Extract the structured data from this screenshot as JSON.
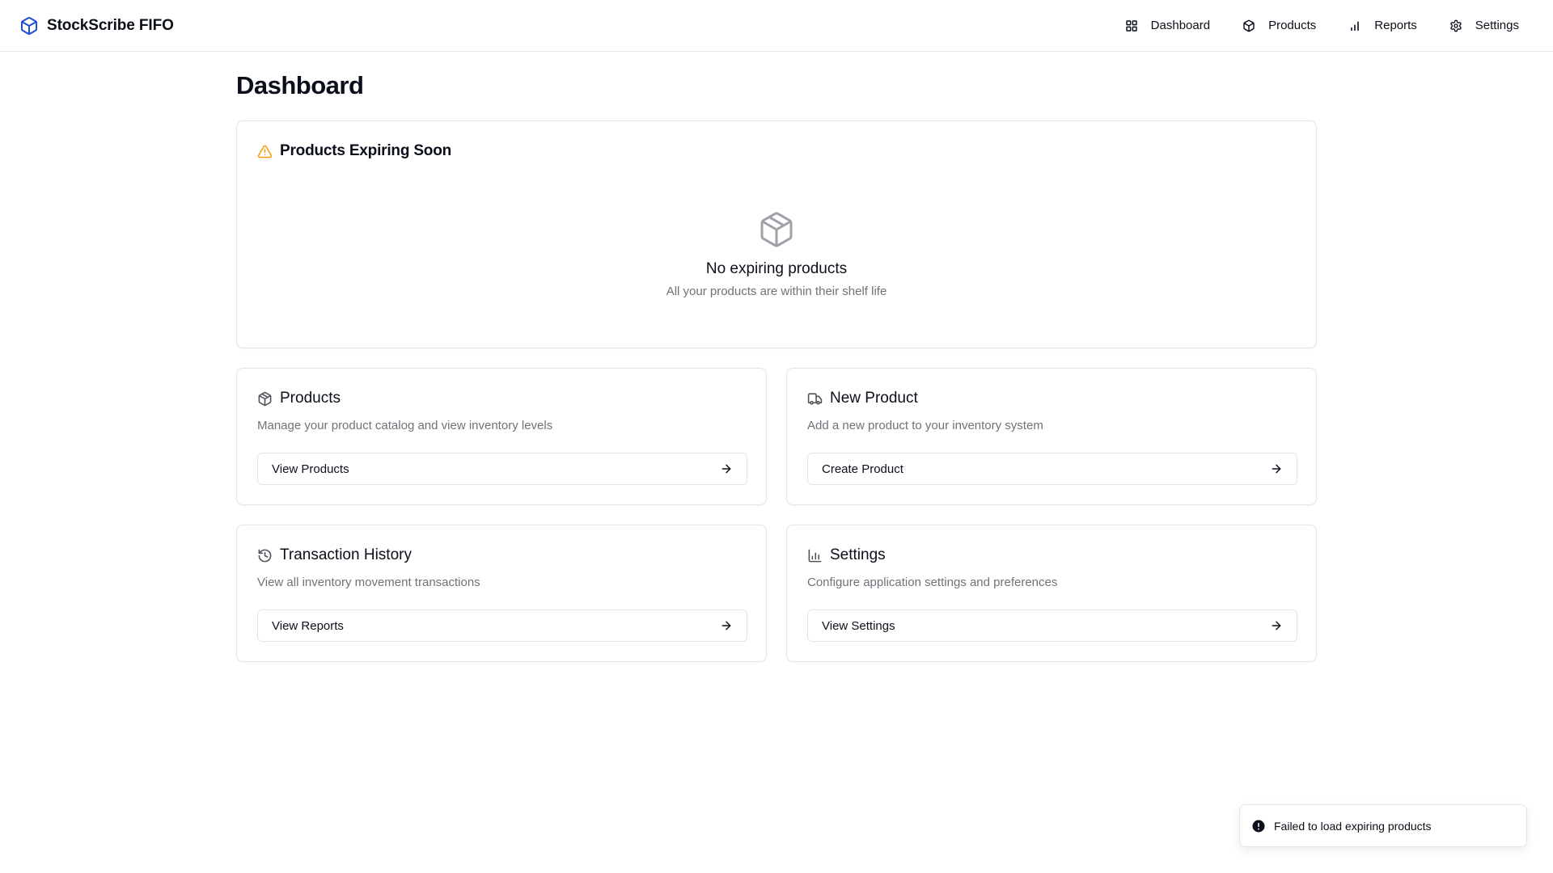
{
  "app": {
    "name": "StockScribe FIFO",
    "logo_icon": "box-icon",
    "accent_color": "#1d4ed8"
  },
  "nav": {
    "items": [
      {
        "label": "Dashboard",
        "icon": "grid-icon"
      },
      {
        "label": "Products",
        "icon": "box-icon"
      },
      {
        "label": "Reports",
        "icon": "bar-chart-icon"
      },
      {
        "label": "Settings",
        "icon": "gear-icon"
      }
    ]
  },
  "page": {
    "title": "Dashboard"
  },
  "expiring": {
    "title": "Products Expiring Soon",
    "icon": "warning-triangle-icon",
    "warning_color": "#f59e0b",
    "empty_title": "No expiring products",
    "empty_subtitle": "All your products are within their shelf life"
  },
  "cards": [
    {
      "title": "Products",
      "icon": "box-icon",
      "description": "Manage your product catalog and view inventory levels",
      "button_label": "View Products"
    },
    {
      "title": "New Product",
      "icon": "truck-icon",
      "description": "Add a new product to your inventory system",
      "button_label": "Create Product"
    },
    {
      "title": "Transaction History",
      "icon": "history-icon",
      "description": "View all inventory movement transactions",
      "button_label": "View Reports"
    },
    {
      "title": "Settings",
      "icon": "bar-chart-icon",
      "description": "Configure application settings and preferences",
      "button_label": "View Settings"
    }
  ],
  "toast": {
    "message": "Failed to load expiring products",
    "icon": "alert-circle-icon"
  }
}
